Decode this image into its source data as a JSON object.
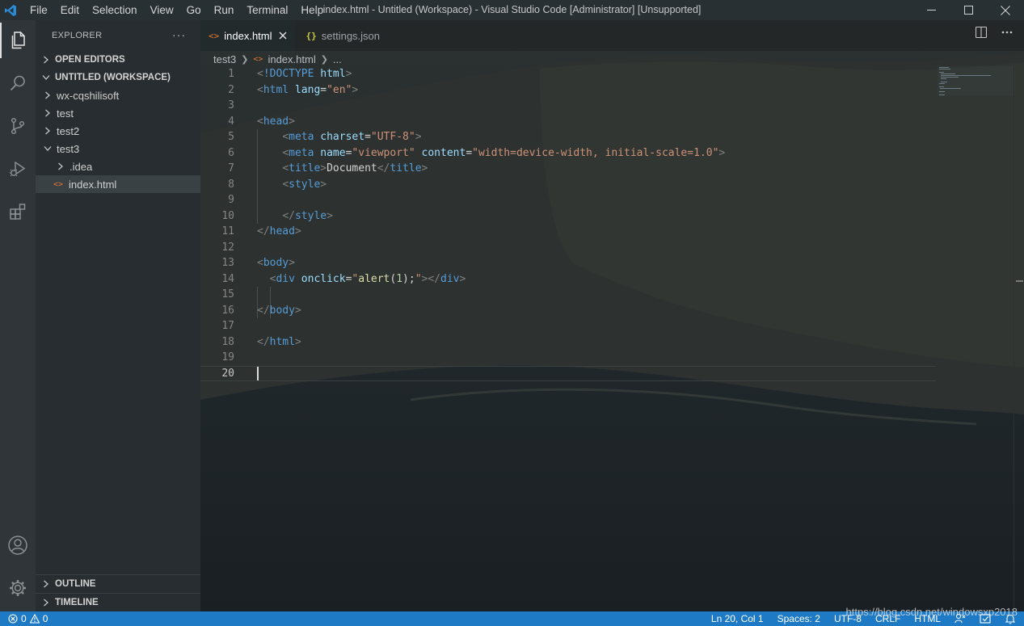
{
  "titlebar": {
    "menu": [
      "File",
      "Edit",
      "Selection",
      "View",
      "Go",
      "Run",
      "Terminal",
      "Help"
    ],
    "title": "index.html - Untitled (Workspace) - Visual Studio Code [Administrator] [Unsupported]"
  },
  "activitybar": {
    "icons": [
      "explorer-icon",
      "search-icon",
      "source-control-icon",
      "run-debug-icon",
      "extensions-icon",
      "accounts-icon",
      "manage-gear-icon"
    ]
  },
  "sidebar": {
    "title": "EXPLORER",
    "more": "···",
    "open_editors": "OPEN EDITORS",
    "workspace": "UNTITLED (WORKSPACE)",
    "tree": [
      {
        "label": "wx-cqshilisoft"
      },
      {
        "label": "test"
      },
      {
        "label": "test2"
      },
      {
        "label": "test3"
      },
      {
        "label": ".idea"
      },
      {
        "label": "index.html"
      }
    ],
    "outline": "OUTLINE",
    "timeline": "TIMELINE"
  },
  "tabs": [
    {
      "label": "index.html",
      "icon": "<>",
      "active": true
    },
    {
      "label": "settings.json",
      "icon": "{}",
      "active": false
    }
  ],
  "breadcrumb": {
    "folder": "test3",
    "file_icon": "<>",
    "file": "index.html",
    "rest": "..."
  },
  "code": {
    "line_numbers": [
      "1",
      "2",
      "3",
      "4",
      "5",
      "6",
      "7",
      "8",
      "9",
      "10",
      "11",
      "12",
      "13",
      "14",
      "15",
      "16",
      "17",
      "18",
      "19",
      "20"
    ]
  },
  "colors": {
    "statusbar": "#1e7ac5",
    "tag": "#569cd6",
    "attr": "#9cdcfe",
    "string": "#ce9178",
    "html_icon": "#e37933",
    "json_icon": "#cbcb41"
  },
  "statusbar": {
    "errors": "0",
    "warnings": "0",
    "position": "Ln 20, Col 1",
    "spaces": "Spaces: 2",
    "encoding": "UTF-8",
    "eol": "CRLF",
    "language": "HTML"
  },
  "watermark": "https://blog.csdn.net/windowsxp2018"
}
